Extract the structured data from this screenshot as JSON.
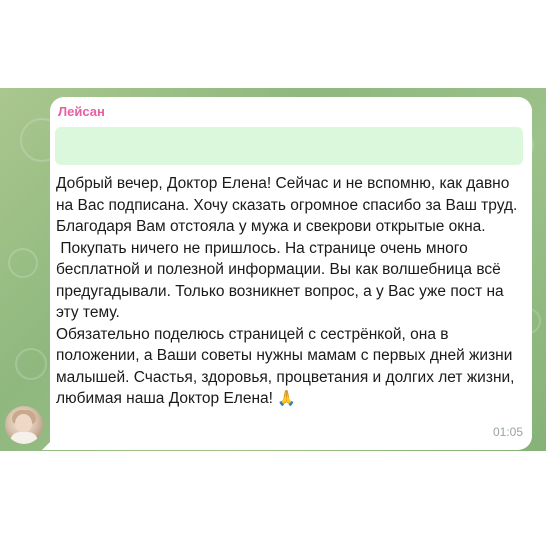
{
  "message": {
    "sender": "Лейсан",
    "text": "Добрый вечер, Доктор Елена! Сейчас и не вспомню, как давно на Вас подписана. Хочу сказать огромное спасибо за Ваш труд. Благодаря Вам отстояла у мужа и свекрови открытые окна.\n Покупать ничего не пришлось. На странице очень много бесплатной и полезной информации. Вы как волшебница всё предугадывали. Только возникнет вопрос, а у Вас уже пост на эту тему.\nОбязательно поделюсь страницей с сестрёнкой, она в положении, а Ваши советы нужны мамам с первых дней жизни малышей. Счастья, здоровья, процветания и долгих лет жизни, любимая наша Доктор Елена!",
    "emoji": "🙏",
    "time": "01:05"
  },
  "icons": {
    "avatar": "user-avatar",
    "emoji": "folded-hands-icon"
  },
  "colors": {
    "sender": "#e85ea3",
    "quote_bg": "#dcf8dc",
    "chat_bg": "#9cc18a",
    "time": "#9aa3a8"
  }
}
